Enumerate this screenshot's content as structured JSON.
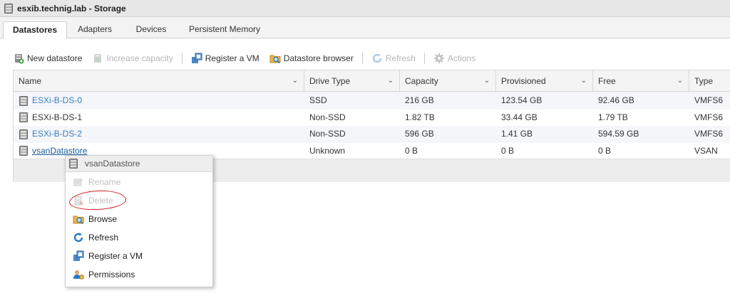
{
  "window": {
    "title": "esxib.technig.lab - Storage"
  },
  "tabs": [
    {
      "label": "Datastores",
      "active": true
    },
    {
      "label": "Adapters",
      "active": false
    },
    {
      "label": "Devices",
      "active": false
    },
    {
      "label": "Persistent Memory",
      "active": false
    }
  ],
  "toolbar": {
    "new_datastore": "New datastore",
    "increase_capacity": "Increase capacity",
    "register_vm": "Register a VM",
    "datastore_browser": "Datastore browser",
    "refresh": "Refresh",
    "actions": "Actions"
  },
  "table": {
    "columns": [
      "Name",
      "Drive Type",
      "Capacity",
      "Provisioned",
      "Free",
      "Type"
    ],
    "rows": [
      {
        "name": "ESXi-B-DS-0",
        "drive_type": "SSD",
        "capacity": "216 GB",
        "provisioned": "123.54 GB",
        "free": "92.46 GB",
        "type": "VMFS6"
      },
      {
        "name": "ESXi-B-DS-1",
        "drive_type": "Non-SSD",
        "capacity": "1.82 TB",
        "provisioned": "33.44 GB",
        "free": "1.79 TB",
        "type": "VMFS6"
      },
      {
        "name": "ESXi-B-DS-2",
        "drive_type": "Non-SSD",
        "capacity": "596 GB",
        "provisioned": "1.41 GB",
        "free": "594.59 GB",
        "type": "VMFS6"
      },
      {
        "name": "vsanDatastore",
        "drive_type": "Unknown",
        "capacity": "0 B",
        "provisioned": "0 B",
        "free": "0 B",
        "type": "VSAN"
      }
    ]
  },
  "context_menu": {
    "header": "vsanDatastore",
    "items": [
      {
        "label": "Rename",
        "enabled": false,
        "icon": "rename-icon"
      },
      {
        "label": "Delete",
        "enabled": false,
        "icon": "delete-icon"
      },
      {
        "label": "Browse",
        "enabled": true,
        "icon": "browse-icon"
      },
      {
        "label": "Refresh",
        "enabled": true,
        "icon": "refresh-icon"
      },
      {
        "label": "Register a VM",
        "enabled": true,
        "icon": "register-vm-icon"
      },
      {
        "label": "Permissions",
        "enabled": true,
        "icon": "permissions-icon"
      }
    ]
  },
  "colors": {
    "link": "#3c7dc0",
    "annotation": "#d11e1e",
    "accent_green": "#3a9a3a",
    "accent_blue": "#2b78c5"
  }
}
